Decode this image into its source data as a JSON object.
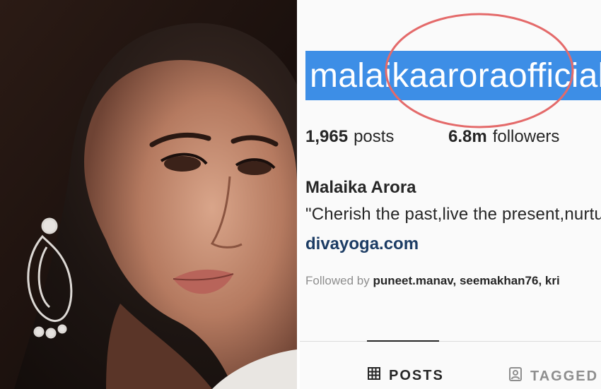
{
  "profile": {
    "username": "malaikaaroraofficial",
    "posts_count": "1,965",
    "posts_label": "posts",
    "followers_count": "6.8m",
    "followers_label": "followers",
    "full_name": "Malaika Arora",
    "bio": "\"Cherish the past,live the present,nurture the future\"",
    "website": "divayoga.com",
    "followed_by_prefix": "Followed by",
    "followed_by_names": "puneet.manav, seemakhan76, kri"
  },
  "tabs": [
    {
      "label": "POSTS",
      "icon": "grid-icon",
      "active": true
    },
    {
      "label": "TAGGED",
      "icon": "tag-icon",
      "active": false
    }
  ],
  "colors": {
    "selection": "#3d8ee6",
    "annotation_circle": "#e46a6a",
    "link": "#1c3c64",
    "muted": "#8e8e8e"
  }
}
